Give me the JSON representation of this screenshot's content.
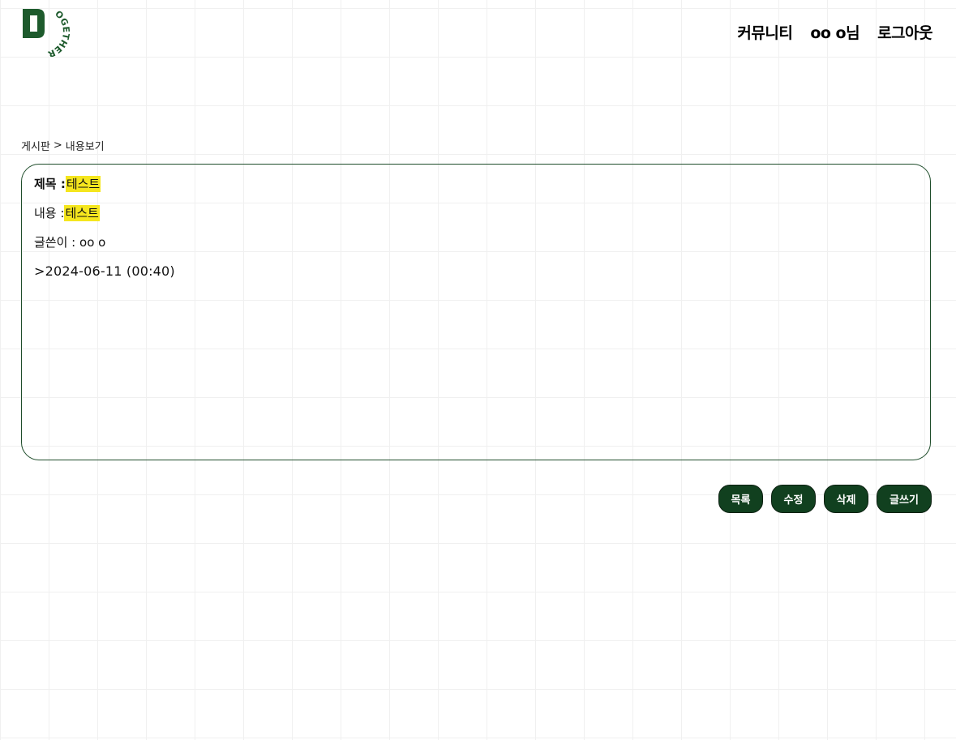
{
  "logo": {
    "letter": "D",
    "arc_text": "OGETHER",
    "color": "#1d5a2c"
  },
  "nav": {
    "community": "커뮤니티",
    "user": "oo o님",
    "logout": "로그아웃"
  },
  "breadcrumb": {
    "board": "게시판",
    "separator": ">",
    "current": "내용보기"
  },
  "post": {
    "title_label": "제목 :",
    "title_value": "테스트",
    "content_label": "내용 :",
    "content_value": "테스트",
    "author_label": "글쓴이 :",
    "author_value": "oo o",
    "date": ">2024-06-11 (00:40)"
  },
  "actions": {
    "list": "목록",
    "edit": "수정",
    "delete": "삭제",
    "write": "글쓰기"
  },
  "colors": {
    "accent": "#11401f",
    "highlight": "#f5e61e",
    "border": "#1f4d2b"
  }
}
